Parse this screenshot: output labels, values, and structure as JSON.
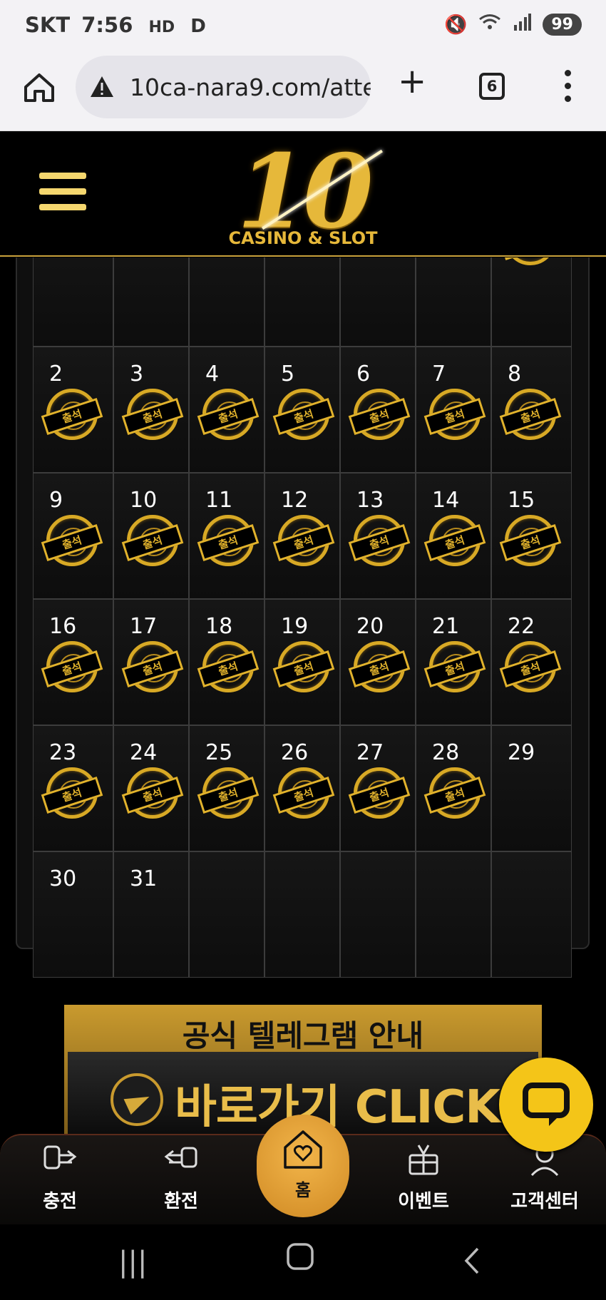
{
  "status_bar": {
    "carrier": "SKT",
    "time": "7:56",
    "hd": "HD",
    "d_mark": "D",
    "battery": "99"
  },
  "browser": {
    "url": "10ca-nara9.com/atte",
    "tab_count": "6"
  },
  "site": {
    "logo_number": "10",
    "logo_sub": "CASINO & SLOT"
  },
  "calendar": {
    "stamp_label": "출석",
    "weeks": [
      [
        {
          "day": "",
          "stamp": false
        },
        {
          "day": "",
          "stamp": false
        },
        {
          "day": "",
          "stamp": false
        },
        {
          "day": "",
          "stamp": false
        },
        {
          "day": "",
          "stamp": false
        },
        {
          "day": "",
          "stamp": false
        },
        {
          "day": "",
          "stamp": true
        }
      ],
      [
        {
          "day": "2",
          "stamp": true
        },
        {
          "day": "3",
          "stamp": true
        },
        {
          "day": "4",
          "stamp": true
        },
        {
          "day": "5",
          "stamp": true
        },
        {
          "day": "6",
          "stamp": true
        },
        {
          "day": "7",
          "stamp": true
        },
        {
          "day": "8",
          "stamp": true
        }
      ],
      [
        {
          "day": "9",
          "stamp": true
        },
        {
          "day": "10",
          "stamp": true
        },
        {
          "day": "11",
          "stamp": true
        },
        {
          "day": "12",
          "stamp": true
        },
        {
          "day": "13",
          "stamp": true
        },
        {
          "day": "14",
          "stamp": true
        },
        {
          "day": "15",
          "stamp": true
        }
      ],
      [
        {
          "day": "16",
          "stamp": true
        },
        {
          "day": "17",
          "stamp": true
        },
        {
          "day": "18",
          "stamp": true
        },
        {
          "day": "19",
          "stamp": true
        },
        {
          "day": "20",
          "stamp": true
        },
        {
          "day": "21",
          "stamp": true
        },
        {
          "day": "22",
          "stamp": true
        }
      ],
      [
        {
          "day": "23",
          "stamp": true
        },
        {
          "day": "24",
          "stamp": true
        },
        {
          "day": "25",
          "stamp": true
        },
        {
          "day": "26",
          "stamp": true
        },
        {
          "day": "27",
          "stamp": true
        },
        {
          "day": "28",
          "stamp": true
        },
        {
          "day": "29",
          "stamp": false
        }
      ],
      [
        {
          "day": "30",
          "stamp": false
        },
        {
          "day": "31",
          "stamp": false
        },
        {
          "day": "",
          "stamp": false
        },
        {
          "day": "",
          "stamp": false
        },
        {
          "day": "",
          "stamp": false
        },
        {
          "day": "",
          "stamp": false
        },
        {
          "day": "",
          "stamp": false
        }
      ]
    ]
  },
  "banner": {
    "headline": "공식 텔레그램 안내",
    "cta": "바로가기 CLICK"
  },
  "bottom_nav": {
    "deposit": "충전",
    "withdraw": "환전",
    "home": "홈",
    "event": "이벤트",
    "support": "고객센터"
  },
  "colors": {
    "gold": "#e6b83a",
    "chat": "#f4c518",
    "home_fab": "#e0a23a"
  }
}
